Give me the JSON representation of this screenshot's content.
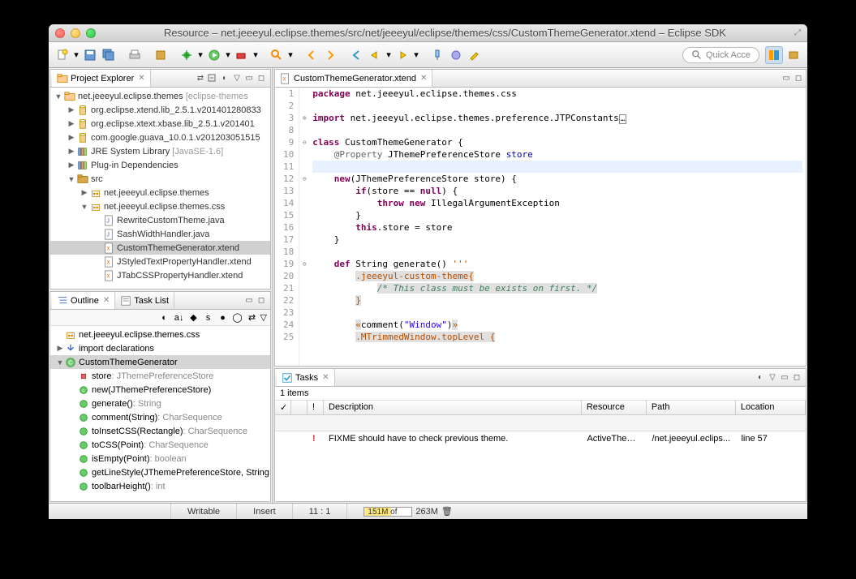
{
  "window": {
    "title": "Resource – net.jeeeyul.eclipse.themes/src/net/jeeeyul/eclipse/themes/css/CustomThemeGenerator.xtend – Eclipse SDK"
  },
  "toolbar": {
    "quick_access": "Quick Acce"
  },
  "explorer": {
    "title": "Project Explorer",
    "items": [
      {
        "d": 0,
        "exp": "open",
        "icon": "project",
        "label": "net.jeeeyul.eclipse.themes",
        "decor": "[eclipse-themes"
      },
      {
        "d": 1,
        "exp": "closed",
        "icon": "jar",
        "label": "org.eclipse.xtend.lib_2.5.1.v201401280833"
      },
      {
        "d": 1,
        "exp": "closed",
        "icon": "jar",
        "label": "org.eclipse.xtext.xbase.lib_2.5.1.v201401"
      },
      {
        "d": 1,
        "exp": "closed",
        "icon": "jar",
        "label": "com.google.guava_10.0.1.v201203051515"
      },
      {
        "d": 1,
        "exp": "closed",
        "icon": "lib",
        "label": "JRE System Library",
        "decor": "[JavaSE-1.6]"
      },
      {
        "d": 1,
        "exp": "closed",
        "icon": "lib",
        "label": "Plug-in Dependencies"
      },
      {
        "d": 1,
        "exp": "open",
        "icon": "srcfolder",
        "label": "src"
      },
      {
        "d": 2,
        "exp": "closed",
        "icon": "package",
        "label": "net.jeeeyul.eclipse.themes"
      },
      {
        "d": 2,
        "exp": "open",
        "icon": "package",
        "label": "net.jeeeyul.eclipse.themes.css"
      },
      {
        "d": 3,
        "exp": "none",
        "icon": "java",
        "label": "RewriteCustomTheme.java"
      },
      {
        "d": 3,
        "exp": "none",
        "icon": "java",
        "label": "SashWidthHandler.java"
      },
      {
        "d": 3,
        "exp": "none",
        "icon": "xtend",
        "label": "CustomThemeGenerator.xtend",
        "selected": true
      },
      {
        "d": 3,
        "exp": "none",
        "icon": "xtend",
        "label": "JStyledTextPropertyHandler.xtend"
      },
      {
        "d": 3,
        "exp": "none",
        "icon": "xtend",
        "label": "JTabCSSPropertyHandler.xtend"
      }
    ]
  },
  "outline": {
    "title": "Outline",
    "task_list_tab": "Task List",
    "items": [
      {
        "d": 0,
        "icon": "package",
        "label": "net.jeeeyul.eclipse.themes.css"
      },
      {
        "d": 0,
        "icon": "import",
        "label": "import declarations",
        "exp": "closed"
      },
      {
        "d": 0,
        "icon": "class",
        "label": "CustomThemeGenerator",
        "exp": "open",
        "selected": true
      },
      {
        "d": 1,
        "icon": "field",
        "label": "store",
        "type": ": JThemePreferenceStore"
      },
      {
        "d": 1,
        "icon": "ctor",
        "label": "new(JThemePreferenceStore)"
      },
      {
        "d": 1,
        "icon": "method",
        "label": "generate()",
        "type": ": String"
      },
      {
        "d": 1,
        "icon": "method",
        "label": "comment(String)",
        "type": ": CharSequence"
      },
      {
        "d": 1,
        "icon": "method",
        "label": "toInsetCSS(Rectangle)",
        "type": ": CharSequence"
      },
      {
        "d": 1,
        "icon": "method",
        "label": "toCSS(Point)",
        "type": ": CharSequence"
      },
      {
        "d": 1,
        "icon": "method",
        "label": "isEmpty(Point)",
        "type": ": boolean"
      },
      {
        "d": 1,
        "icon": "method",
        "label": "getLineStyle(JThemePreferenceStore, String"
      },
      {
        "d": 1,
        "icon": "method",
        "label": "toolbarHeight()",
        "type": ": int"
      }
    ]
  },
  "editor": {
    "tab": "CustomThemeGenerator.xtend",
    "lines": [
      {
        "n": 1,
        "tokens": [
          [
            "kw",
            "package"
          ],
          [
            "",
            " net.jeeeyul.eclipse.themes.css"
          ]
        ]
      },
      {
        "n": 2,
        "tokens": []
      },
      {
        "n": 3,
        "fold": "plus",
        "tokens": [
          [
            "kw",
            "import"
          ],
          [
            "",
            " net.jeeeyul.eclipse.themes.preference.JTPConstants"
          ],
          [
            "box",
            "[]"
          ]
        ]
      },
      {
        "n": 8,
        "tokens": []
      },
      {
        "n": 9,
        "fold": "minus",
        "tokens": [
          [
            "kw",
            "class"
          ],
          [
            "",
            " CustomThemeGenerator {"
          ]
        ]
      },
      {
        "n": 10,
        "tokens": [
          [
            "",
            "    "
          ],
          [
            "anno",
            "@Property"
          ],
          [
            "",
            " JThemePreferenceStore "
          ],
          [
            "field",
            "store"
          ]
        ]
      },
      {
        "n": 11,
        "hl": true,
        "tokens": []
      },
      {
        "n": 12,
        "fold": "minus",
        "tokens": [
          [
            "",
            "    "
          ],
          [
            "kw",
            "new"
          ],
          [
            "",
            "(JThemePreferenceStore store) {"
          ]
        ]
      },
      {
        "n": 13,
        "tokens": [
          [
            "",
            "        "
          ],
          [
            "kw",
            "if"
          ],
          [
            "",
            "(store == "
          ],
          [
            "kw",
            "null"
          ],
          [
            "",
            ") {"
          ]
        ]
      },
      {
        "n": 14,
        "tokens": [
          [
            "",
            "            "
          ],
          [
            "kw",
            "throw new"
          ],
          [
            "",
            " IllegalArgumentException"
          ]
        ]
      },
      {
        "n": 15,
        "tokens": [
          [
            "",
            "        }"
          ]
        ]
      },
      {
        "n": 16,
        "tokens": [
          [
            "",
            "        "
          ],
          [
            "kw",
            "this"
          ],
          [
            "",
            ".store = store"
          ]
        ]
      },
      {
        "n": 17,
        "tokens": [
          [
            "",
            "    }"
          ]
        ]
      },
      {
        "n": 18,
        "tokens": []
      },
      {
        "n": 19,
        "fold": "minus",
        "tokens": [
          [
            "",
            "    "
          ],
          [
            "kw",
            "def"
          ],
          [
            "",
            " String generate() "
          ],
          [
            "richstr",
            "'''"
          ]
        ]
      },
      {
        "n": 20,
        "templ": true,
        "tokens": [
          [
            "",
            "        "
          ],
          [
            "richstr",
            ".jeeeyul-custom-theme{"
          ]
        ]
      },
      {
        "n": 21,
        "templ": true,
        "tokens": [
          [
            "",
            "            "
          ],
          [
            "com",
            "/* This class must be exists on first. */"
          ]
        ]
      },
      {
        "n": 22,
        "templ": true,
        "tokens": [
          [
            "",
            "        "
          ],
          [
            "richstr",
            "}"
          ]
        ]
      },
      {
        "n": 23,
        "tokens": []
      },
      {
        "n": 24,
        "templ": true,
        "tokens": [
          [
            "",
            "        "
          ],
          [
            "richstr",
            "«"
          ],
          [
            "",
            "comment("
          ],
          [
            "str",
            "\"Window\""
          ],
          [
            "",
            ")"
          ],
          [
            "richstr",
            "»"
          ]
        ]
      },
      {
        "n": 25,
        "templ": true,
        "tokens": [
          [
            "",
            "        "
          ],
          [
            "richstr",
            ".MTrimmedWindow.topLevel {"
          ]
        ]
      }
    ]
  },
  "tasks": {
    "title": "Tasks",
    "count": "1 items",
    "columns": {
      "c1": "✓",
      "c2": "",
      "c3": "!",
      "desc": "Description",
      "res": "Resource",
      "path": "Path",
      "loc": "Location"
    },
    "rows": [
      {
        "priority": "!",
        "desc": "FIXME should have to check previous theme.",
        "res": "ActiveTheme...",
        "path": "/net.jeeeyul.eclips...",
        "loc": "line 57"
      }
    ]
  },
  "status": {
    "writable": "Writable",
    "insert": "Insert",
    "pos": "11 : 1",
    "mem_used": "151M of",
    "mem_total": "263M",
    "mem_pct": 57
  }
}
